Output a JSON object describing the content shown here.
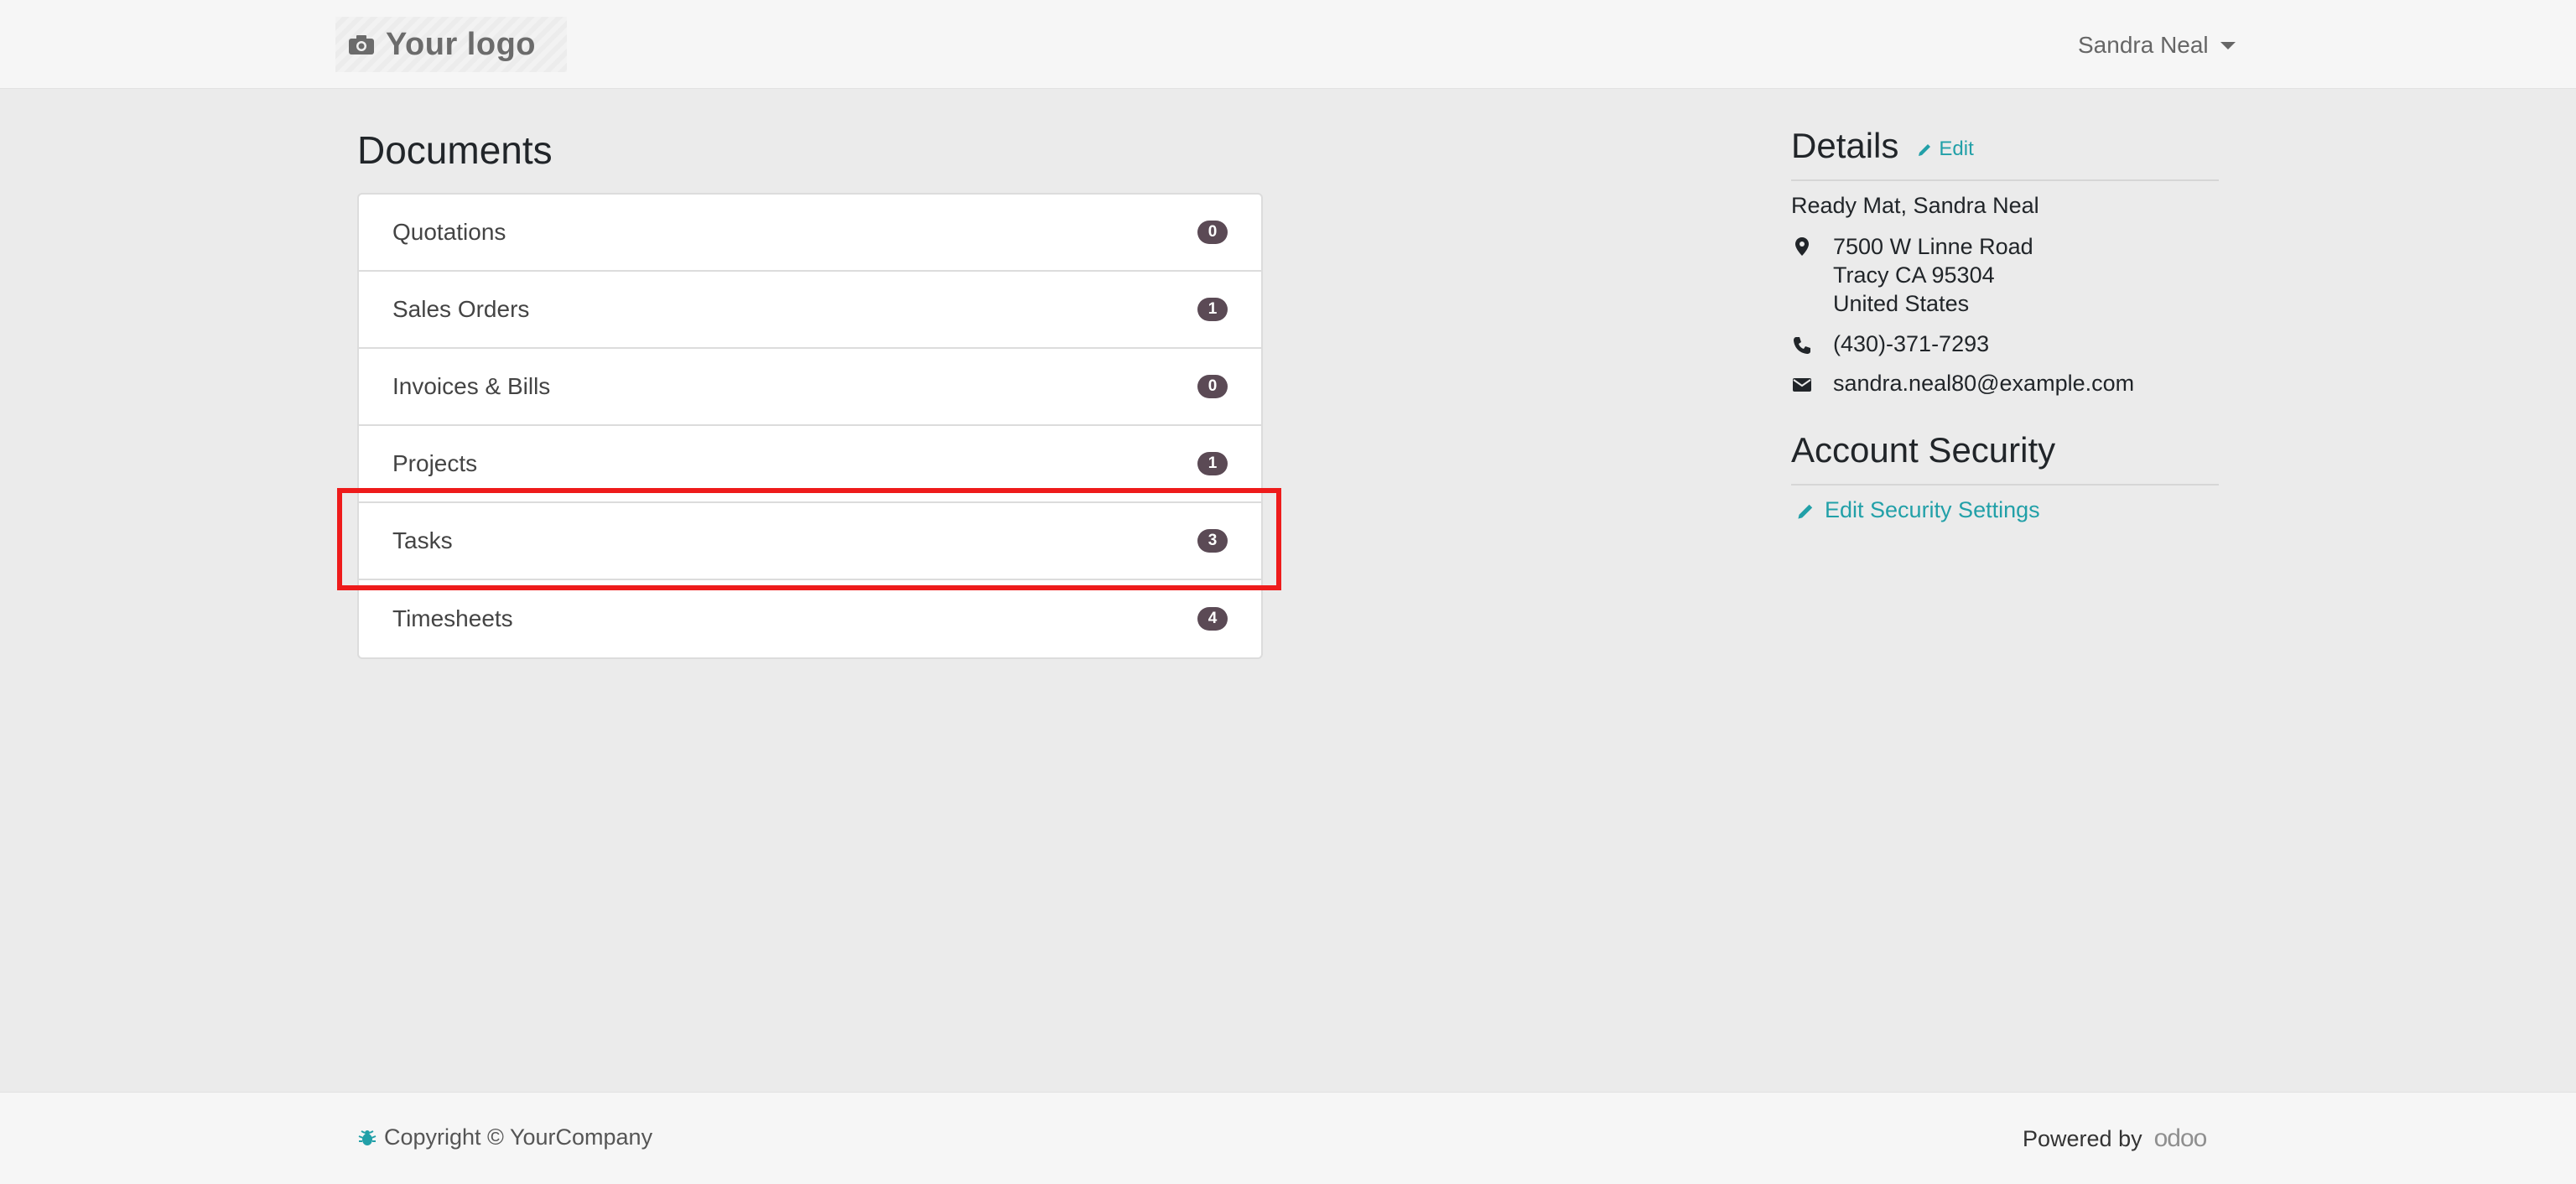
{
  "header": {
    "logo_text": "Your logo",
    "logo_icon": "camera-icon",
    "user_name": "Sandra Neal"
  },
  "documents": {
    "title": "Documents",
    "items": [
      {
        "label": "Quotations",
        "count": "0"
      },
      {
        "label": "Sales Orders",
        "count": "1"
      },
      {
        "label": "Invoices & Bills",
        "count": "0"
      },
      {
        "label": "Projects",
        "count": "1"
      },
      {
        "label": "Tasks",
        "count": "3"
      },
      {
        "label": "Timesheets",
        "count": "4"
      }
    ],
    "highlighted_item": "Tasks"
  },
  "details": {
    "title": "Details",
    "edit_label": "Edit",
    "company_contact": "Ready Mat, Sandra Neal",
    "address_lines": [
      "7500 W Linne Road",
      "Tracy CA 95304",
      "United States"
    ],
    "phone": "(430)-371-7293",
    "email": "sandra.neal80@example.com"
  },
  "account_security": {
    "title": "Account Security",
    "edit_link": "Edit Security Settings"
  },
  "footer": {
    "copyright": "Copyright © YourCompany",
    "powered_by": "Powered by",
    "brand": "odoo"
  },
  "colors": {
    "accent": "#22a0a8",
    "badge": "#5b4a55",
    "highlight": "#ee1b1b"
  }
}
